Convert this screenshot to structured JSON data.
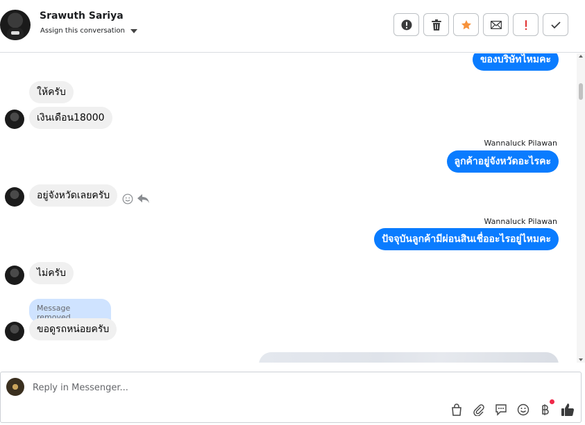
{
  "header": {
    "contact_name": "Srawuth Sariya",
    "assign_label": "Assign this conversation",
    "actions": [
      {
        "name": "spam-alert-button",
        "icon": "exclamation-circle-icon"
      },
      {
        "name": "delete-button",
        "icon": "trash-icon"
      },
      {
        "name": "star-button",
        "icon": "star-icon",
        "color": "#f7923b"
      },
      {
        "name": "mark-unread-button",
        "icon": "envelope-icon"
      },
      {
        "name": "mark-important-button",
        "icon": "exclamation-icon",
        "color": "#e02e2e"
      },
      {
        "name": "mark-done-button",
        "icon": "checkmark-icon"
      }
    ]
  },
  "thread": {
    "messages": [
      {
        "id": "m1",
        "direction": "out",
        "text": "ของบริษัทไหมคะ"
      },
      {
        "id": "m2",
        "direction": "in",
        "text": "ให้ครับ"
      },
      {
        "id": "m3",
        "direction": "in",
        "text": "เงินเดือน18000"
      },
      {
        "id": "m4",
        "direction": "out",
        "sender": "Wannaluck Pilawan",
        "text": "ลูกค้าอยู่จังหวัดอะไรคะ"
      },
      {
        "id": "m5",
        "direction": "in",
        "text": "อยู่จังหวัดเลยครับ"
      },
      {
        "id": "m6",
        "direction": "out",
        "sender": "Wannaluck Pilawan",
        "text": "ปัจจุบันลูกค้ามีผ่อนสินเชื่ออะไรอยู่ไหมคะ"
      },
      {
        "id": "m7",
        "direction": "in",
        "text": "ไม่ครับ"
      },
      {
        "id": "m8",
        "direction": "in",
        "removed": true,
        "text": "Message removed"
      },
      {
        "id": "m9",
        "direction": "in",
        "text": "ขอดูรถหน่อยครับ"
      }
    ]
  },
  "composer": {
    "placeholder": "Reply in Messenger...",
    "tools": [
      "shopping-bag-icon",
      "paperclip-icon",
      "saved-reply-icon",
      "emoji-icon",
      "baht-payment-icon",
      "thumbs-up-icon"
    ]
  },
  "colors": {
    "accent": "#0a7cff",
    "incoming_bubble": "#f0f0f0",
    "removed_bubble": "#cfe3ff"
  }
}
